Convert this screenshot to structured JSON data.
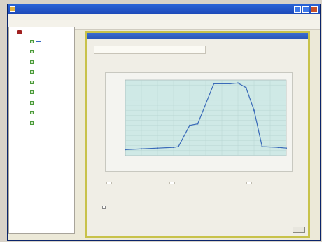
{
  "window": {
    "title": ""
  },
  "menu": [],
  "sidebar": {
    "root_label": "",
    "items": [
      {
        "label": "",
        "selected": true
      },
      {
        "label": "",
        "selected": false
      },
      {
        "label": "",
        "selected": false
      },
      {
        "label": "",
        "selected": false
      },
      {
        "label": "",
        "selected": false
      },
      {
        "label": "",
        "selected": false
      },
      {
        "label": "",
        "selected": false
      },
      {
        "label": "",
        "selected": false
      },
      {
        "label": "",
        "selected": false
      }
    ]
  },
  "panel": {
    "title": "",
    "info_text": ""
  },
  "fields": [
    {
      "label": "",
      "value": ""
    },
    {
      "label": "",
      "value": ""
    },
    {
      "label": "",
      "value": ""
    }
  ],
  "checkbox_label": "",
  "ok_label": "",
  "colors": {
    "accent": "#2a63d6",
    "panel_border": "#c8c24a",
    "plot_bg": "#cfe9e6",
    "line": "#3a6ab8"
  },
  "chart_data": {
    "type": "line",
    "title": "",
    "xlabel": "",
    "ylabel": "",
    "grid": true,
    "xlim": [
      0,
      100
    ],
    "ylim": [
      0,
      100
    ],
    "series": [
      {
        "x": [
          0,
          10,
          20,
          30,
          33,
          40,
          45,
          55,
          65,
          70,
          75,
          80,
          85,
          95,
          100
        ],
        "y": [
          8,
          9,
          10,
          11,
          12,
          40,
          42,
          95,
          95,
          96,
          90,
          60,
          12,
          11,
          10
        ]
      }
    ]
  }
}
